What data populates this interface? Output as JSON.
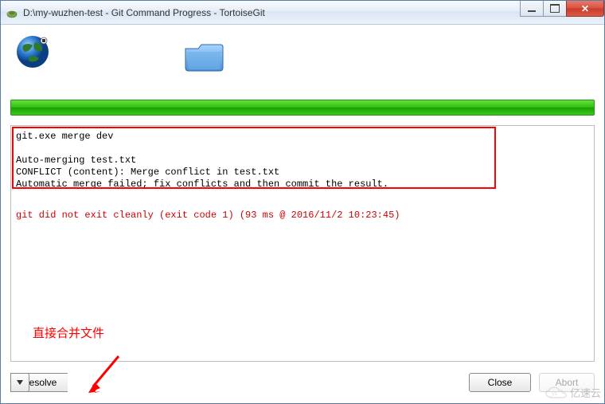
{
  "titlebar": {
    "title": "D:\\my-wuzhen-test - Git Command Progress - TortoiseGit"
  },
  "icons": {
    "globe": "globe-icon",
    "folder": "folder-icon",
    "app": "tortoise-icon"
  },
  "progress": {
    "percent": 100
  },
  "output": {
    "lines": [
      "git.exe merge dev",
      "",
      "Auto-merging test.txt",
      "CONFLICT (content): Merge conflict in test.txt",
      "Automatic merge failed; fix conflicts and then commit the result."
    ],
    "error_line": "git did not exit cleanly (exit code 1) (93 ms @ 2016/11/2 10:23:45)"
  },
  "annotation": {
    "text": "直接合并文件"
  },
  "buttons": {
    "resolve": "Resolve",
    "close": "Close",
    "abort": "Abort"
  },
  "watermark": {
    "text": "亿速云"
  }
}
